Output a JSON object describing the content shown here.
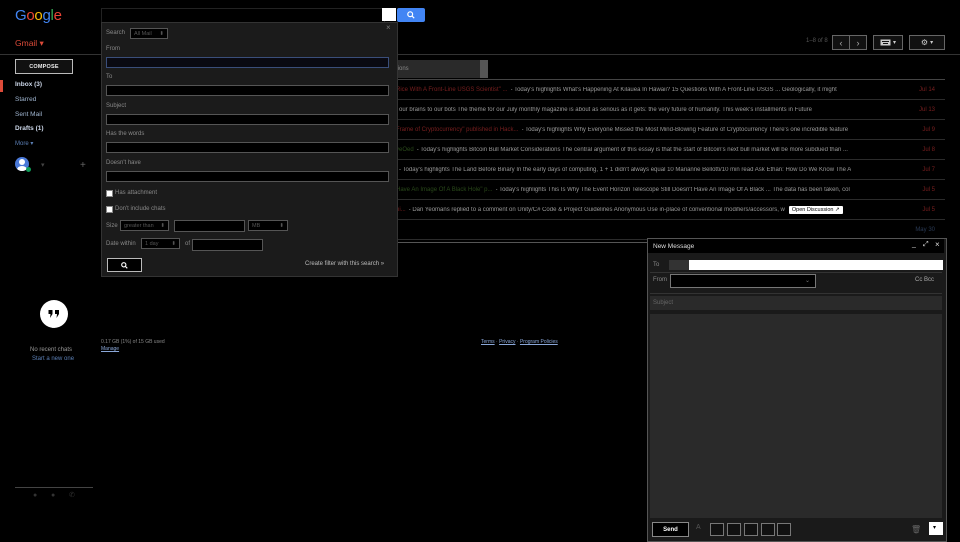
{
  "header": {
    "logo": {
      "letters": [
        "G",
        "o",
        "o",
        "g",
        "l",
        "e"
      ],
      "colors": [
        "#4285f4",
        "#ea4335",
        "#fbbc05",
        "#4285f4",
        "#34a853",
        "#ea4335"
      ]
    },
    "app_menu": "Gmail ▾",
    "pagination": "1–8 of 8"
  },
  "icons": {
    "search": "magnifier-icon",
    "prev": "chevron-left-icon",
    "next": "chevron-right-icon",
    "keyboard": "keyboard-icon",
    "settings": "gear-icon",
    "hangouts": "quote-bubble-icon"
  },
  "sidebar": {
    "compose": "COMPOSE",
    "items": [
      {
        "label": "Inbox (3)",
        "bold": true
      },
      {
        "label": "Starred",
        "bold": false
      },
      {
        "label": "Sent Mail",
        "bold": false
      },
      {
        "label": "Drafts (1)",
        "bold": true
      }
    ],
    "more": "More ▾",
    "hangouts": {
      "no_chats": "No recent chats",
      "start_new": "Start a new one"
    }
  },
  "tab_partial": "tions",
  "mail_rows": [
    {
      "subject": "Rice With A Front-Line USGS Scientist\" ...",
      "snippet": "- Today's highlights What's Happening At Kilauea In Hawaii? 15 Questions With A Front-Line USGS ... Geologically, it might",
      "date": "Jul 14",
      "green": false
    },
    {
      "subject": "",
      "snippet": "our brains to our bots The theme for our July monthly magazine is about as serious as it gets: the very future of humanity. This week's installments in Future",
      "date": "Jul 13",
      "green": false
    },
    {
      "subject": "Frame of Cryptocurrency\" published in Hack...",
      "snippet": "- Today's highlights Why Everyone Missed the Most Mind-Blowing Feature of Cryptocurrency There's one incredible feature",
      "date": "Jul 9",
      "green": false
    },
    {
      "subject": "veOed",
      "snippet": "- Today's highlights Bitcoin Bull Market Considerations The central argument of this essay is that the start of Bitcoin's next bull market will be more subdued than ...",
      "date": "Jul 8",
      "green": true
    },
    {
      "subject": "",
      "snippet": "- Today's highlights The Land Before Binary In the early days of computing, 1 + 1 didn't always equal 10 Marianne Bellotti/10 min read Ask Ethan: How Do We Know The A",
      "date": "Jul 7",
      "green": false
    },
    {
      "subject": "Have An Image Of A Black Hole\" p...",
      "snippet": "- Today's highlights This Is Why The Event Horizon Telescope Still Doesn't Have An Image Of A Black ... The data has been taken, col",
      "date": "Jul 5",
      "green": true
    },
    {
      "subject": "ni...",
      "snippet": "- Dan Yeomans replied to a comment on Unity/C# Code & Project Guidelines Anonymous Use in-place of conventional modifiers/accessors, w",
      "date": "Jul 5",
      "green": false,
      "button": "Open Discussion ↗"
    },
    {
      "subject": "",
      "snippet": "",
      "date": "May 30",
      "green": false
    }
  ],
  "search_popup": {
    "close": "×",
    "search_label": "Search",
    "search_scope": "All Mail",
    "from": "From",
    "to": "To",
    "subject": "Subject",
    "has_words": "Has the words",
    "doesnt_have": "Doesn't have",
    "has_attachment": "Has attachment",
    "dont_include_chats": "Don't include chats",
    "size_label": "Size",
    "size_op": "greater than",
    "size_unit": "MB",
    "date_label": "Date within",
    "date_range": "1 day",
    "of_label": "of",
    "create_filter": "Create filter with this search »"
  },
  "footer": {
    "storage": "0.17 GB (1%) of 15 GB used",
    "manage": "Manage",
    "terms": "Terms",
    "privacy": "Privacy",
    "program": "Program Policies",
    "sep": " · "
  },
  "compose_window": {
    "title": "New Message",
    "min": "_",
    "expand": "⤢",
    "close": "×",
    "to": "To",
    "from": "From",
    "cc_bcc": "Cc  Bcc",
    "subject_placeholder": "Subject",
    "send": "Send"
  }
}
